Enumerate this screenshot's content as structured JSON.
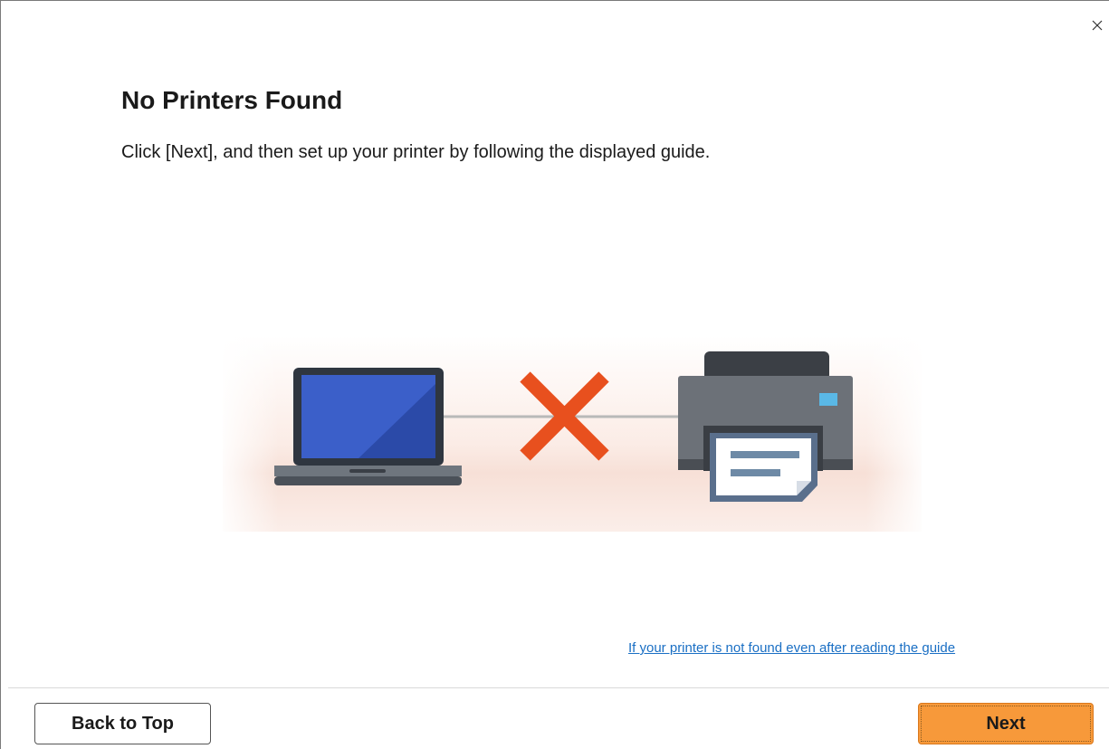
{
  "dialog": {
    "title": "No Printers Found",
    "instruction": "Click [Next], and then set up your printer by following the displayed guide.",
    "help_link": "If your printer is not found even after reading the guide",
    "close_icon": "close-icon",
    "illustration": {
      "laptop_icon": "laptop-icon",
      "error_icon": "x-mark-icon",
      "printer_icon": "printer-icon",
      "error_color": "#e8501e",
      "screen_color": "#3a5fc8"
    }
  },
  "footer": {
    "back_label": "Back to Top",
    "next_label": "Next",
    "next_color": "#f7993a"
  }
}
